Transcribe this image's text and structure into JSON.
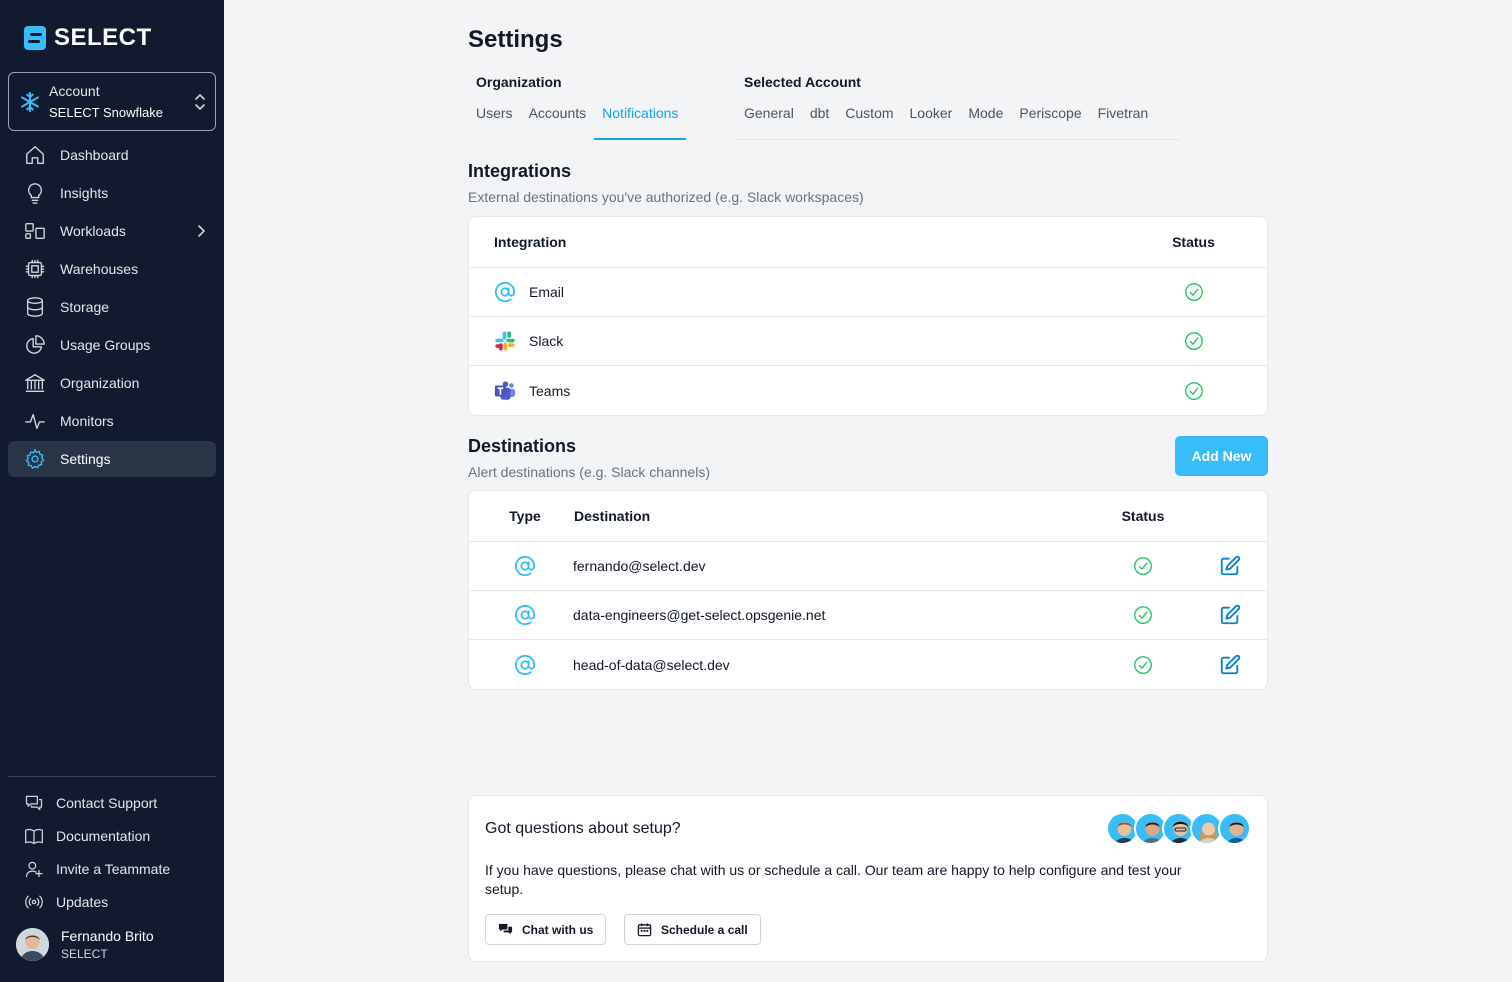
{
  "brand": {
    "name": "SELECT"
  },
  "account": {
    "label": "Account",
    "name": "SELECT Snowflake"
  },
  "nav": {
    "items": [
      {
        "label": "Dashboard",
        "icon": "home-icon"
      },
      {
        "label": "Insights",
        "icon": "lightbulb-icon"
      },
      {
        "label": "Workloads",
        "icon": "workloads-icon"
      },
      {
        "label": "Warehouses",
        "icon": "chip-icon"
      },
      {
        "label": "Storage",
        "icon": "database-icon"
      },
      {
        "label": "Usage Groups",
        "icon": "pie-icon"
      },
      {
        "label": "Organization",
        "icon": "bank-icon"
      },
      {
        "label": "Monitors",
        "icon": "pulse-icon"
      },
      {
        "label": "Settings",
        "icon": "gear-icon"
      }
    ],
    "active": "Settings"
  },
  "bottom_nav": {
    "items": [
      {
        "label": "Contact Support",
        "icon": "chat-icon"
      },
      {
        "label": "Documentation",
        "icon": "book-icon"
      },
      {
        "label": "Invite a Teammate",
        "icon": "user-plus-icon"
      },
      {
        "label": "Updates",
        "icon": "broadcast-icon"
      }
    ]
  },
  "user": {
    "name": "Fernando Brito",
    "org": "SELECT"
  },
  "page": {
    "title": "Settings"
  },
  "tabs": {
    "org_label": "Organization",
    "org_tabs": [
      "Users",
      "Accounts",
      "Notifications"
    ],
    "account_label": "Selected Account",
    "account_tabs": [
      "General",
      "dbt",
      "Custom",
      "Looker",
      "Mode",
      "Periscope",
      "Fivetran"
    ],
    "active": "Notifications"
  },
  "integrations": {
    "title": "Integrations",
    "subtitle": "External destinations you've authorized (e.g. Slack workspaces)",
    "col_integration": "Integration",
    "col_status": "Status",
    "rows": [
      {
        "name": "Email",
        "icon": "at-icon",
        "status": "connected"
      },
      {
        "name": "Slack",
        "icon": "slack-icon",
        "status": "connected"
      },
      {
        "name": "Teams",
        "icon": "teams-icon",
        "status": "connected"
      }
    ]
  },
  "destinations": {
    "title": "Destinations",
    "subtitle": "Alert destinations (e.g. Slack channels)",
    "add_button": "Add New",
    "col_type": "Type",
    "col_destination": "Destination",
    "col_status": "Status",
    "rows": [
      {
        "type": "email",
        "destination": "fernando@select.dev",
        "status": "active"
      },
      {
        "type": "email",
        "destination": "data-engineers@get-select.opsgenie.net",
        "status": "active"
      },
      {
        "type": "email",
        "destination": "head-of-data@select.dev",
        "status": "active"
      }
    ]
  },
  "help": {
    "title": "Got questions about setup?",
    "text": "If you have questions, please chat with us or schedule a call. Our team are happy to help configure and test your setup.",
    "chat_button": "Chat with us",
    "schedule_button": "Schedule a call"
  },
  "colors": {
    "sidebar_bg": "#111a2e",
    "accent": "#38bdf8",
    "success": "#22c55e",
    "edit": "#0284c7"
  }
}
